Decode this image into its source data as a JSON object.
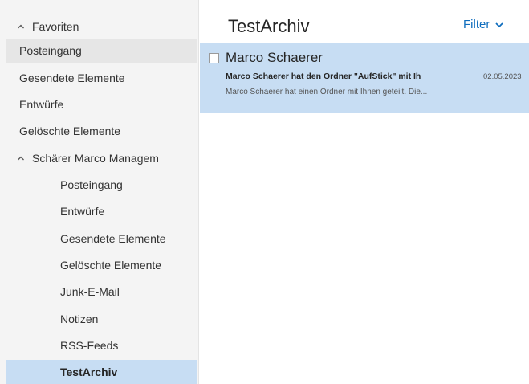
{
  "sidebar": {
    "favorites": {
      "label": "Favoriten",
      "expanded": true,
      "items": [
        {
          "label": "Posteingang",
          "state": "hover"
        },
        {
          "label": "Gesendete Elemente"
        },
        {
          "label": "Entwürfe"
        },
        {
          "label": "Gelöschte Elemente"
        }
      ]
    },
    "account": {
      "label": "Schärer Marco Managem",
      "expanded": true,
      "items": [
        {
          "label": "Posteingang"
        },
        {
          "label": "Entwürfe"
        },
        {
          "label": "Gesendete Elemente"
        },
        {
          "label": "Gelöschte Elemente"
        },
        {
          "label": "Junk-E-Mail"
        },
        {
          "label": "Notizen"
        },
        {
          "label": "RSS-Feeds"
        },
        {
          "label": "TestArchiv",
          "state": "selected"
        }
      ]
    }
  },
  "list": {
    "title": "TestArchiv",
    "filter_label": "Filter",
    "messages": [
      {
        "sender": "Marco Schaerer",
        "subject": "Marco Schaerer hat den Ordner \"AufStick\" mit Ih",
        "date": "02.05.2023",
        "preview": "Marco Schaerer hat einen Ordner mit Ihnen geteilt.  Die..."
      }
    ]
  },
  "icons": {
    "expand": "chevron-up-icon",
    "filter": "chevron-down-icon"
  },
  "colors": {
    "accent": "#106ebe",
    "selection": "#c7ddf3",
    "sidebar_bg": "#f4f4f4"
  }
}
